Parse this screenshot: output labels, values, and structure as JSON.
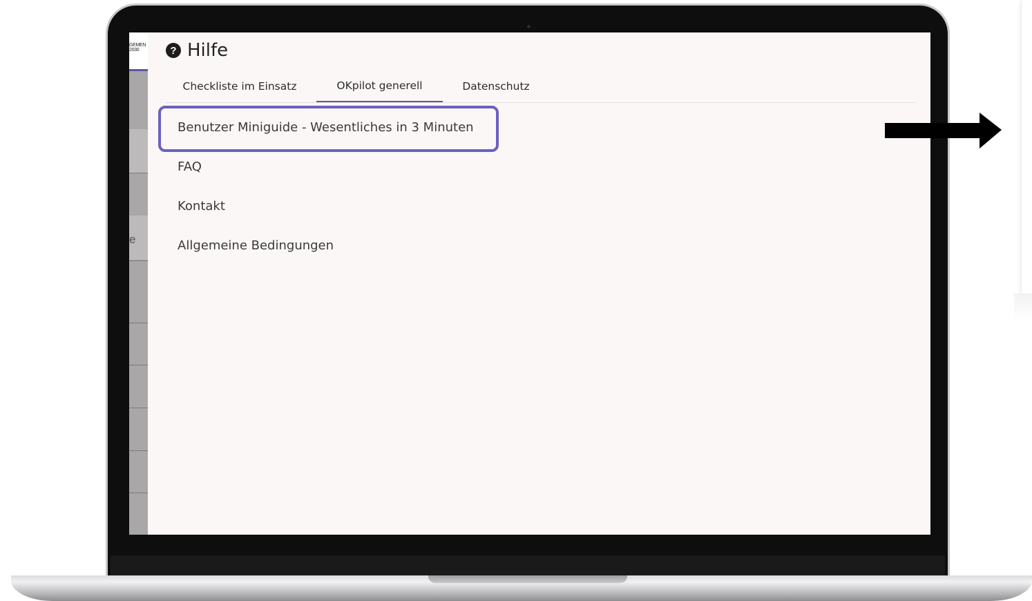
{
  "app": {
    "sidebar_logo_text": "GEMEN\n2030",
    "sidebar_partial_letter": "e"
  },
  "header": {
    "icon": "question-circle-icon",
    "icon_glyph": "?",
    "title": "Hilfe"
  },
  "tabs": [
    {
      "label": "Checkliste im Einsatz",
      "active": false
    },
    {
      "label": "OKpilot generell",
      "active": true
    },
    {
      "label": "Datenschutz",
      "active": false
    }
  ],
  "menu": {
    "items": [
      {
        "label": "Benutzer Miniguide - Wesentliches in 3 Minuten",
        "highlighted": true
      },
      {
        "label": "FAQ"
      },
      {
        "label": "Kontakt"
      },
      {
        "label": "Allgemeine Bedingungen"
      }
    ]
  },
  "annotation": {
    "highlight_color": "#6961c0",
    "arrow_icon": "arrow-right-icon"
  },
  "colors": {
    "accent": "#5f56a4",
    "screen_background": "#fbf7f6",
    "sidebar": "#a9a7a8"
  }
}
